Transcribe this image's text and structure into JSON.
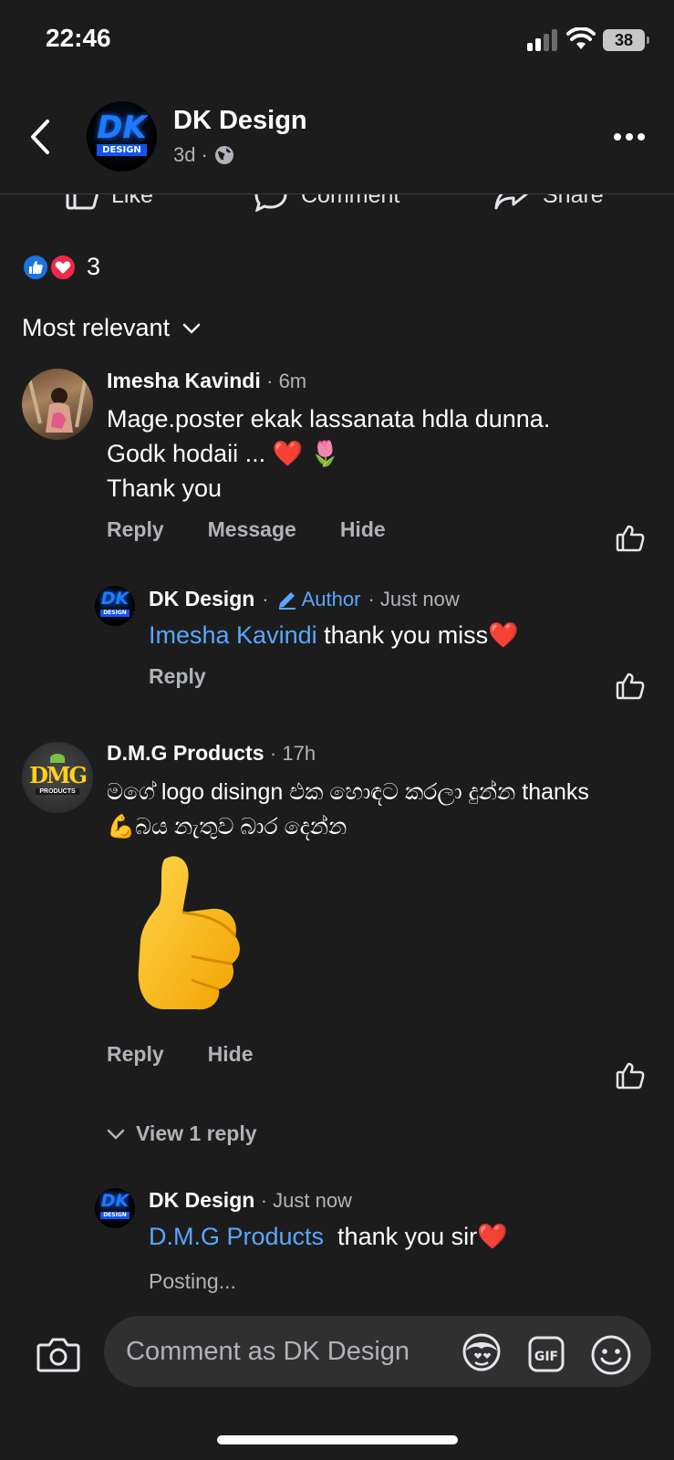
{
  "status_bar": {
    "time": "22:46",
    "battery": "38"
  },
  "header": {
    "page_name": "DK Design",
    "age": "3d",
    "separator": "·"
  },
  "actions": {
    "like": "Like",
    "comment": "Comment",
    "share": "Share"
  },
  "reactions": {
    "count": "3"
  },
  "sort": {
    "label": "Most relevant"
  },
  "logo": {
    "dk": "DK",
    "design": "DESIGN",
    "dmg": "DMG",
    "products": "PRODUCTS"
  },
  "comments": [
    {
      "author": "Imesha Kavindi",
      "time": "· 6m",
      "lines": [
        "Mage.poster ekak lassanata hdla dunna.",
        "Godk hodaii ... ❤️ 🌷",
        "Thank you"
      ],
      "links": [
        "Reply",
        "Message",
        "Hide"
      ]
    },
    {
      "author": "DK Design",
      "time_sep": "·",
      "badge": "Author",
      "time": "· Just now",
      "mention": "Imesha Kavindi",
      "text": " thank you miss❤️",
      "links": [
        "Reply"
      ]
    },
    {
      "author": "D.M.G Products",
      "time": "· 17h",
      "lines": [
        "මගේ logo disingn එක හොඳට කරලා දුන්න thanks",
        "💪බය නැතුව බාර දෙන්න"
      ],
      "sticker": "👍",
      "links": [
        "Reply",
        "Hide"
      ],
      "view_replies": "View 1 reply"
    },
    {
      "author": "DK Design",
      "time": "· Just now",
      "mention": "D.M.G Products",
      "text": "  thank you sir❤️",
      "status": "Posting..."
    }
  ],
  "composer": {
    "placeholder": "Comment as DK Design"
  }
}
